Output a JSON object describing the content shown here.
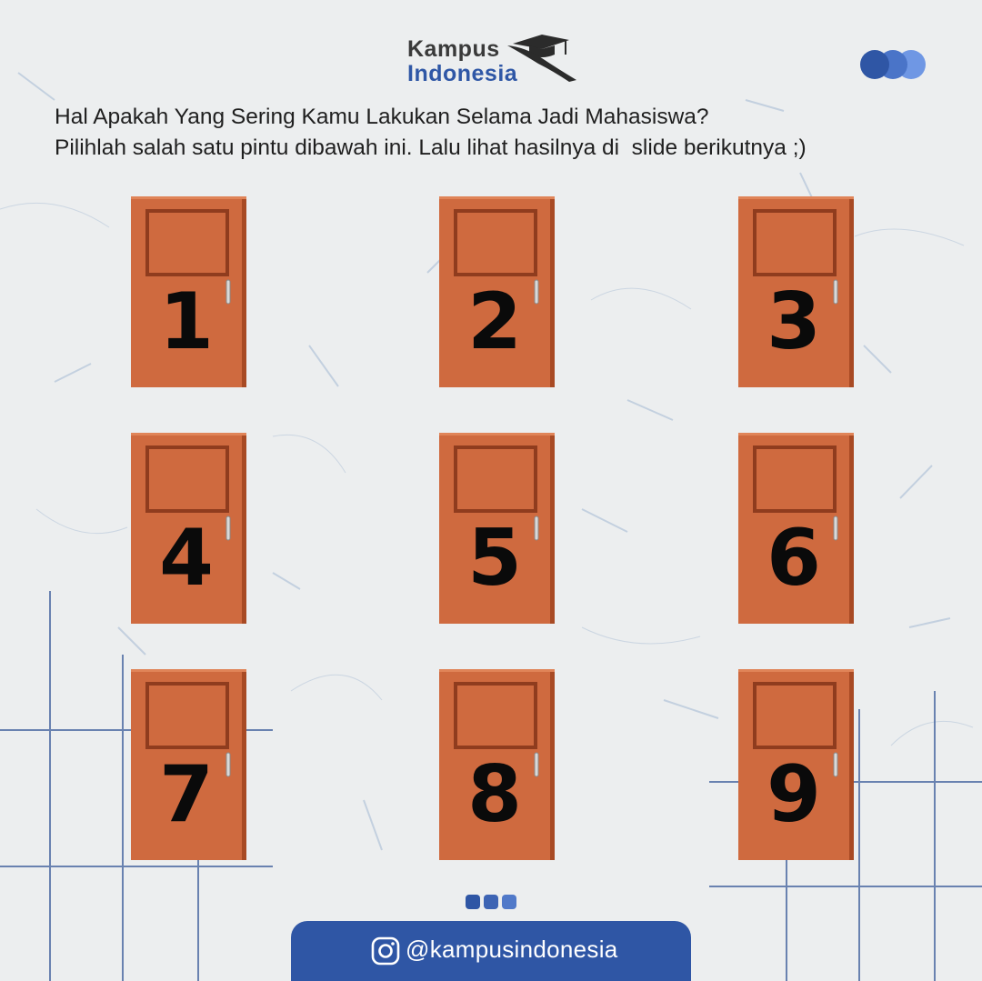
{
  "brand": {
    "name_line1": "Kampus",
    "name_line2": "Indonesia",
    "primary_color": "#2f56a5",
    "dark_color": "#3a3a3a",
    "icon": "graduation-cap-icon"
  },
  "header_dots": {
    "colors": [
      "#2f56a5",
      "#4a74c8",
      "#6f97e4"
    ]
  },
  "question": {
    "line1": "Hal Apakah Yang Sering Kamu Lakukan Selama Jadi Mahasiswa?",
    "line2": "Pilihlah salah satu pintu dibawah ini. Lalu lihat hasilnya di  slide berikutnya ;)"
  },
  "door_color": "#cf6a3f",
  "doors": [
    {
      "number": "1"
    },
    {
      "number": "2"
    },
    {
      "number": "3"
    },
    {
      "number": "4"
    },
    {
      "number": "5"
    },
    {
      "number": "6"
    },
    {
      "number": "7"
    },
    {
      "number": "8"
    },
    {
      "number": "9"
    }
  ],
  "page_dots": {
    "colors": [
      "#2f56a5",
      "#3d64b4",
      "#5079c9"
    ]
  },
  "footer": {
    "handle": "@kampusindonesia",
    "icon": "instagram-icon"
  }
}
